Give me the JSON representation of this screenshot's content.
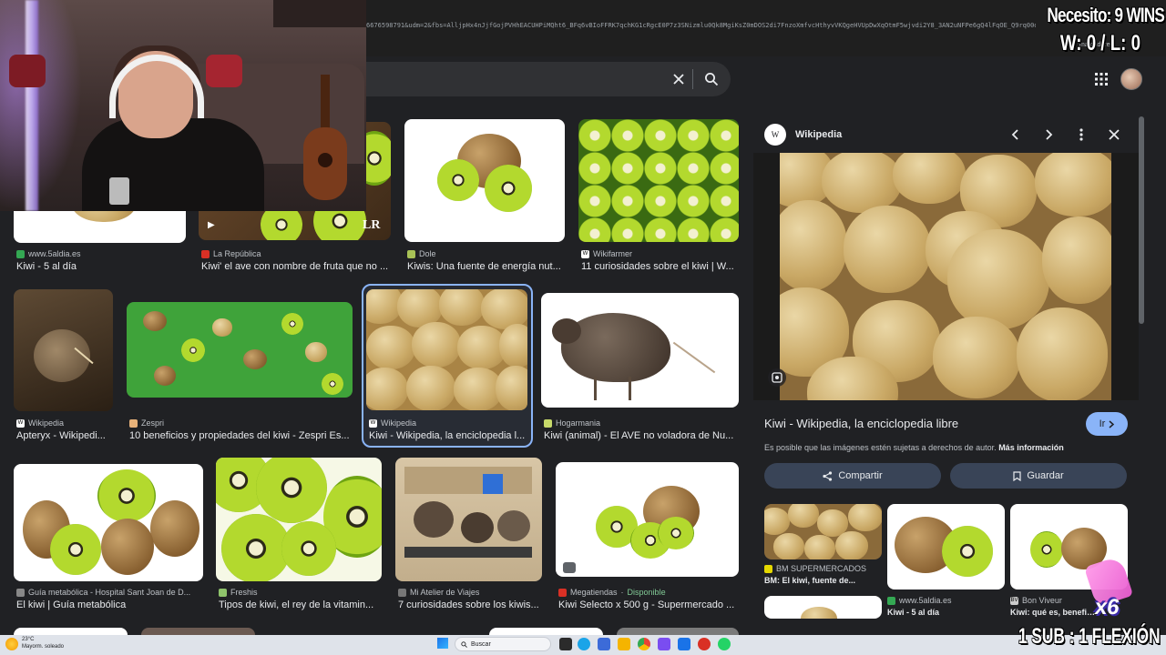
{
  "browser": {
    "url_text": "6676598791&udm=2&fbs=AlljpHx4nJjfGojPVHhEACUHPiMQht6_BFq6vBIoFFRK7qchKG1cRgcE0P7z3SNizmlu0Qk8MgiKsZ0mDOS2di7FnzoXmfvcHthyvVKQgeHVUpDwXqOtmF5wjvdi2Y8_3AN2uNFPe6gQ4lFqOE_Q9rq00oRKfXtebejFH_sO..."
  },
  "search": {
    "clear_icon": "close-icon",
    "search_icon": "search-icon"
  },
  "header": {
    "apps_icon": "apps-grid-icon",
    "avatar": "account-avatar"
  },
  "overlay": {
    "wins_goal": "Necesito: 9 WINS",
    "wins_record": "W: 0 / L: 0",
    "sub_rule": "1 SUB : 1 FLEXIÓN",
    "multiplier": "x6"
  },
  "grid": {
    "row1": [
      {
        "source": "www.5aldia.es",
        "title": "Kiwi - 5 al día",
        "fav_color": "#34a853"
      },
      {
        "source": "La República",
        "title": "Kiwi' el ave con nombre de fruta que no ...",
        "fav_color": "#d93025",
        "badge": "LR"
      },
      {
        "source": "Dole",
        "title": "Kiwis: Una fuente de energía nut...",
        "fav_color": "#a8c256"
      },
      {
        "source": "Wikifarmer",
        "title": "11 curiosidades sobre el kiwi | W...",
        "fav_color": "#ffffff"
      }
    ],
    "row2": [
      {
        "source": "Wikipedia",
        "title": "Apteryx - Wikipedi...",
        "fav_color": "#ffffff"
      },
      {
        "source": "Zespri",
        "title": "10 beneficios y propiedades del kiwi - Zespri Es...",
        "fav_color": "#e8b27a"
      },
      {
        "source": "Wikipedia",
        "title": "Kiwi - Wikipedia, la enciclopedia l...",
        "fav_color": "#ffffff"
      },
      {
        "source": "Hogarmania",
        "title": "Kiwi (animal) - El AVE no voladora de Nu...",
        "fav_color": "#c7d96a"
      }
    ],
    "row3": [
      {
        "source": "Guía metabólica - Hospital Sant Joan de D...",
        "title": "El kiwi | Guía metabólica",
        "fav_color": "#888888"
      },
      {
        "source": "Freshis",
        "title": "Tipos de kiwi, el rey de la vitamin...",
        "fav_color": "#8fc36b"
      },
      {
        "source": "Mi Atelier de Viajes",
        "title": "7 curiosidades sobre los kiwis...",
        "fav_color": "#777777"
      },
      {
        "source": "Megatiendas",
        "availability": "Disponible",
        "title": "Kiwi Selecto x 500 g - Supermercado ...",
        "fav_color": "#d93025"
      }
    ]
  },
  "panel": {
    "site": "Wikipedia",
    "site_letter": "W",
    "title": "Kiwi - Wikipedia, la enciclopedia libre",
    "visit_label": "Ir",
    "copyright": "Es posible que las imágenes estén sujetas a derechos de autor.",
    "more_info": "Más información",
    "share_label": "Compartir",
    "save_label": "Guardar",
    "related": [
      {
        "source": "BM SUPERMERCADOS",
        "title": "BM: El kiwi, fuente de...",
        "fav_color": "#e5d800"
      },
      {
        "source": "www.5aldia.es",
        "title": "Kiwi - 5 al día",
        "fav_color": "#34a853"
      },
      {
        "source": "Bon Viveur",
        "title": "Kiwi: qué es, benefic...",
        "fav_color": "#cccccc",
        "fav_letter": "BV"
      }
    ]
  },
  "taskbar": {
    "weather_temp": "23°C",
    "weather_desc": "Mayorm. soleado",
    "search_label": "Buscar"
  }
}
